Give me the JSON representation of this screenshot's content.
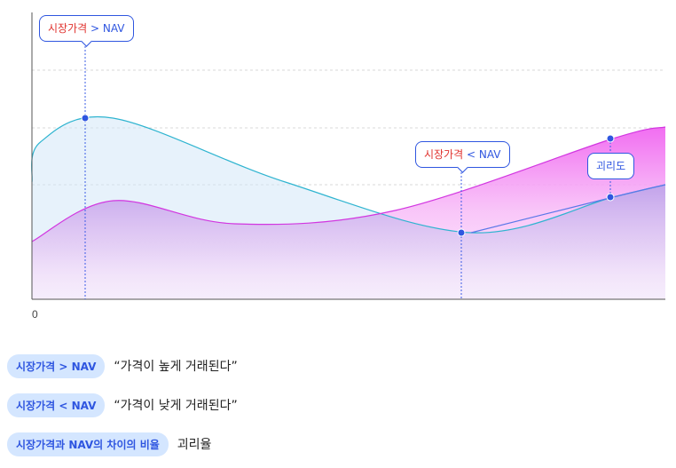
{
  "chart_data": {
    "type": "area",
    "x_tick_labels": [
      "0"
    ],
    "series": [
      {
        "color": "#35c8d8",
        "values": [
          [
            0,
            205
          ],
          [
            10,
            160
          ],
          [
            96,
            133
          ],
          [
            300,
            205
          ],
          [
            520,
            262
          ],
          [
            688,
            222
          ],
          [
            750,
            208
          ]
        ]
      },
      {
        "color": "#e440e8",
        "values": [
          [
            0,
            272
          ],
          [
            96,
            226
          ],
          [
            240,
            252
          ],
          [
            430,
            237
          ],
          [
            688,
            156
          ],
          [
            750,
            143
          ]
        ]
      }
    ],
    "annotations": {
      "premium": {
        "label_a": "시장가격",
        "label_op": ">",
        "label_b": "NAV",
        "point_x": 96
      },
      "discount": {
        "label_a": "시장가격",
        "label_op": "<",
        "label_b": "NAV",
        "point_x": 520
      },
      "gap": {
        "label": "괴리도",
        "point_x": 688
      }
    },
    "grid": true
  },
  "legend": [
    {
      "pill": "시장가격 > NAV",
      "text": "“가격이 높게 거래된다”"
    },
    {
      "pill": "시장가격 < NAV",
      "text": "“가격이 낮게 거래된다”"
    },
    {
      "pill": "시장가격과 NAV의 차이의 비율",
      "text": "괴리율"
    }
  ]
}
